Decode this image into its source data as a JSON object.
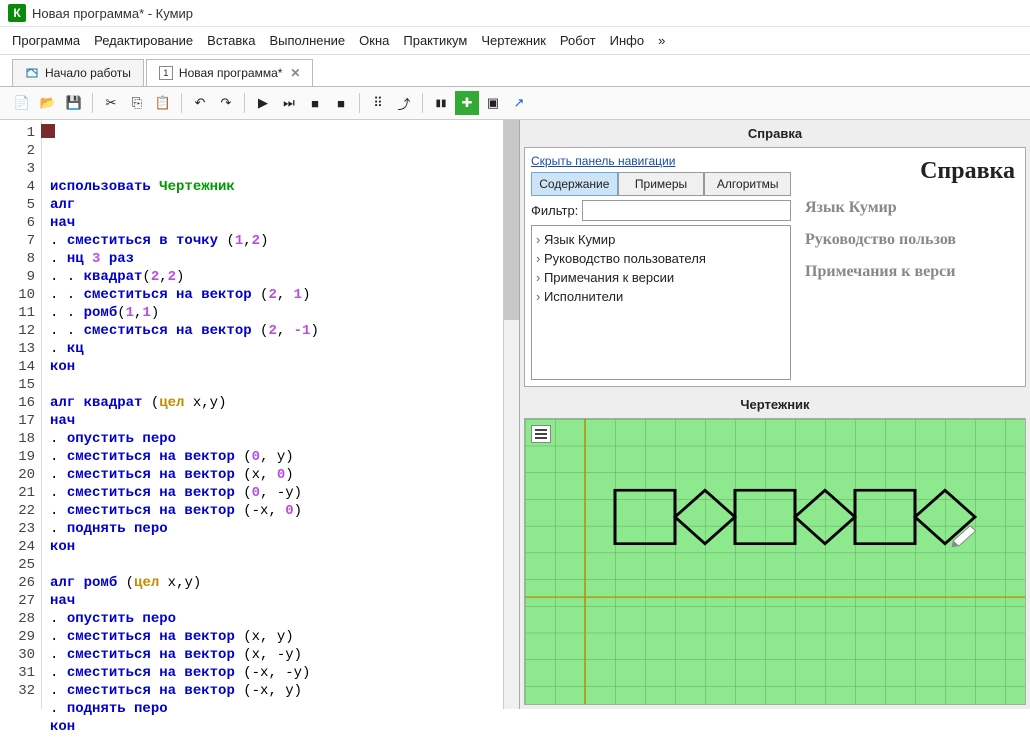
{
  "title": "Новая программа* - Кумир",
  "logo": "К",
  "menu": [
    "Программа",
    "Редактирование",
    "Вставка",
    "Выполнение",
    "Окна",
    "Практикум",
    "Чертежник",
    "Робот",
    "Инфо",
    "»"
  ],
  "tabs": [
    {
      "label": "Начало работы",
      "active": false,
      "closable": false
    },
    {
      "label": "Новая программа*",
      "active": true,
      "closable": true,
      "prefix": "1"
    }
  ],
  "code": {
    "lines": 32,
    "tokens": [
      [
        {
          "c": "kw",
          "t": "использовать "
        },
        {
          "c": "name",
          "t": "Чертежник"
        }
      ],
      [
        {
          "c": "kw",
          "t": "алг"
        }
      ],
      [
        {
          "c": "kw",
          "t": "нач"
        }
      ],
      [
        {
          "c": "plain",
          "t": ". "
        },
        {
          "c": "sys",
          "t": "сместиться в точку"
        },
        {
          "c": "plain",
          "t": " ("
        },
        {
          "c": "num",
          "t": "1"
        },
        {
          "c": "plain",
          "t": ","
        },
        {
          "c": "num",
          "t": "2"
        },
        {
          "c": "plain",
          "t": ")"
        }
      ],
      [
        {
          "c": "plain",
          "t": ". "
        },
        {
          "c": "kw",
          "t": "нц"
        },
        {
          "c": "plain",
          "t": " "
        },
        {
          "c": "num",
          "t": "3"
        },
        {
          "c": "plain",
          "t": " "
        },
        {
          "c": "kw",
          "t": "раз"
        }
      ],
      [
        {
          "c": "plain",
          "t": ". . "
        },
        {
          "c": "sys",
          "t": "квадрат"
        },
        {
          "c": "plain",
          "t": "("
        },
        {
          "c": "num",
          "t": "2"
        },
        {
          "c": "plain",
          "t": ","
        },
        {
          "c": "num",
          "t": "2"
        },
        {
          "c": "plain",
          "t": ")"
        }
      ],
      [
        {
          "c": "plain",
          "t": ". . "
        },
        {
          "c": "sys",
          "t": "сместиться на вектор"
        },
        {
          "c": "plain",
          "t": " ("
        },
        {
          "c": "num",
          "t": "2"
        },
        {
          "c": "plain",
          "t": ", "
        },
        {
          "c": "num",
          "t": "1"
        },
        {
          "c": "plain",
          "t": ")"
        }
      ],
      [
        {
          "c": "plain",
          "t": ". . "
        },
        {
          "c": "sys",
          "t": "ромб"
        },
        {
          "c": "plain",
          "t": "("
        },
        {
          "c": "num",
          "t": "1"
        },
        {
          "c": "plain",
          "t": ","
        },
        {
          "c": "num",
          "t": "1"
        },
        {
          "c": "plain",
          "t": ")"
        }
      ],
      [
        {
          "c": "plain",
          "t": ". . "
        },
        {
          "c": "sys",
          "t": "сместиться на вектор"
        },
        {
          "c": "plain",
          "t": " ("
        },
        {
          "c": "num",
          "t": "2"
        },
        {
          "c": "plain",
          "t": ", "
        },
        {
          "c": "num",
          "t": "-1"
        },
        {
          "c": "plain",
          "t": ")"
        }
      ],
      [
        {
          "c": "plain",
          "t": ". "
        },
        {
          "c": "kw",
          "t": "кц"
        }
      ],
      [
        {
          "c": "kw",
          "t": "кон"
        }
      ],
      [],
      [
        {
          "c": "kw",
          "t": "алг"
        },
        {
          "c": "plain",
          "t": " "
        },
        {
          "c": "sys",
          "t": "квадрат"
        },
        {
          "c": "plain",
          "t": " ("
        },
        {
          "c": "type",
          "t": "цел"
        },
        {
          "c": "plain",
          "t": " x,y)"
        }
      ],
      [
        {
          "c": "kw",
          "t": "нач"
        }
      ],
      [
        {
          "c": "plain",
          "t": ". "
        },
        {
          "c": "sys",
          "t": "опустить перо"
        }
      ],
      [
        {
          "c": "plain",
          "t": ". "
        },
        {
          "c": "sys",
          "t": "сместиться на вектор"
        },
        {
          "c": "plain",
          "t": " ("
        },
        {
          "c": "num",
          "t": "0"
        },
        {
          "c": "plain",
          "t": ", y)"
        }
      ],
      [
        {
          "c": "plain",
          "t": ". "
        },
        {
          "c": "sys",
          "t": "сместиться на вектор"
        },
        {
          "c": "plain",
          "t": " (x, "
        },
        {
          "c": "num",
          "t": "0"
        },
        {
          "c": "plain",
          "t": ")"
        }
      ],
      [
        {
          "c": "plain",
          "t": ". "
        },
        {
          "c": "sys",
          "t": "сместиться на вектор"
        },
        {
          "c": "plain",
          "t": " ("
        },
        {
          "c": "num",
          "t": "0"
        },
        {
          "c": "plain",
          "t": ", -y)"
        }
      ],
      [
        {
          "c": "plain",
          "t": ". "
        },
        {
          "c": "sys",
          "t": "сместиться на вектор"
        },
        {
          "c": "plain",
          "t": " (-x, "
        },
        {
          "c": "num",
          "t": "0"
        },
        {
          "c": "plain",
          "t": ")"
        }
      ],
      [
        {
          "c": "plain",
          "t": ". "
        },
        {
          "c": "sys",
          "t": "поднять перо"
        }
      ],
      [
        {
          "c": "kw",
          "t": "кон"
        }
      ],
      [],
      [
        {
          "c": "kw",
          "t": "алг"
        },
        {
          "c": "plain",
          "t": " "
        },
        {
          "c": "sys",
          "t": "ромб"
        },
        {
          "c": "plain",
          "t": " ("
        },
        {
          "c": "type",
          "t": "цел"
        },
        {
          "c": "plain",
          "t": " x,y)"
        }
      ],
      [
        {
          "c": "kw",
          "t": "нач"
        }
      ],
      [
        {
          "c": "plain",
          "t": ". "
        },
        {
          "c": "sys",
          "t": "опустить перо"
        }
      ],
      [
        {
          "c": "plain",
          "t": ". "
        },
        {
          "c": "sys",
          "t": "сместиться на вектор"
        },
        {
          "c": "plain",
          "t": " (x, y)"
        }
      ],
      [
        {
          "c": "plain",
          "t": ". "
        },
        {
          "c": "sys",
          "t": "сместиться на вектор"
        },
        {
          "c": "plain",
          "t": " (x, -y)"
        }
      ],
      [
        {
          "c": "plain",
          "t": ". "
        },
        {
          "c": "sys",
          "t": "сместиться на вектор"
        },
        {
          "c": "plain",
          "t": " (-x, -y)"
        }
      ],
      [
        {
          "c": "plain",
          "t": ". "
        },
        {
          "c": "sys",
          "t": "сместиться на вектор"
        },
        {
          "c": "plain",
          "t": " (-x, y)"
        }
      ],
      [
        {
          "c": "plain",
          "t": ". "
        },
        {
          "c": "sys",
          "t": "поднять перо"
        }
      ],
      [
        {
          "c": "kw",
          "t": "кон"
        }
      ],
      []
    ]
  },
  "help": {
    "title": "Справка",
    "hide_link": "Скрыть панель навигации",
    "tabs": [
      "Содержание",
      "Примеры",
      "Алгоритмы"
    ],
    "filter_label": "Фильтр:",
    "nav": [
      "Язык Кумир",
      "Руководство пользователя",
      "Примечания к версии",
      "Исполнители"
    ],
    "content": {
      "heading": "Справка",
      "links": [
        "Язык Кумир",
        "Руководство пользов",
        "Примечания к верси"
      ]
    }
  },
  "drawer": {
    "title": "Чертежник"
  },
  "icons": {
    "new": "📄",
    "open": "📂",
    "save": "💾",
    "cut": "✂",
    "copy": "⎘",
    "paste": "📋",
    "undo": "↶",
    "redo": "↷",
    "run": "▶",
    "step": "⏭",
    "stop": "■",
    "grid": "▦",
    "green": "◻",
    "tiles": "▣",
    "arrow": "↗"
  }
}
